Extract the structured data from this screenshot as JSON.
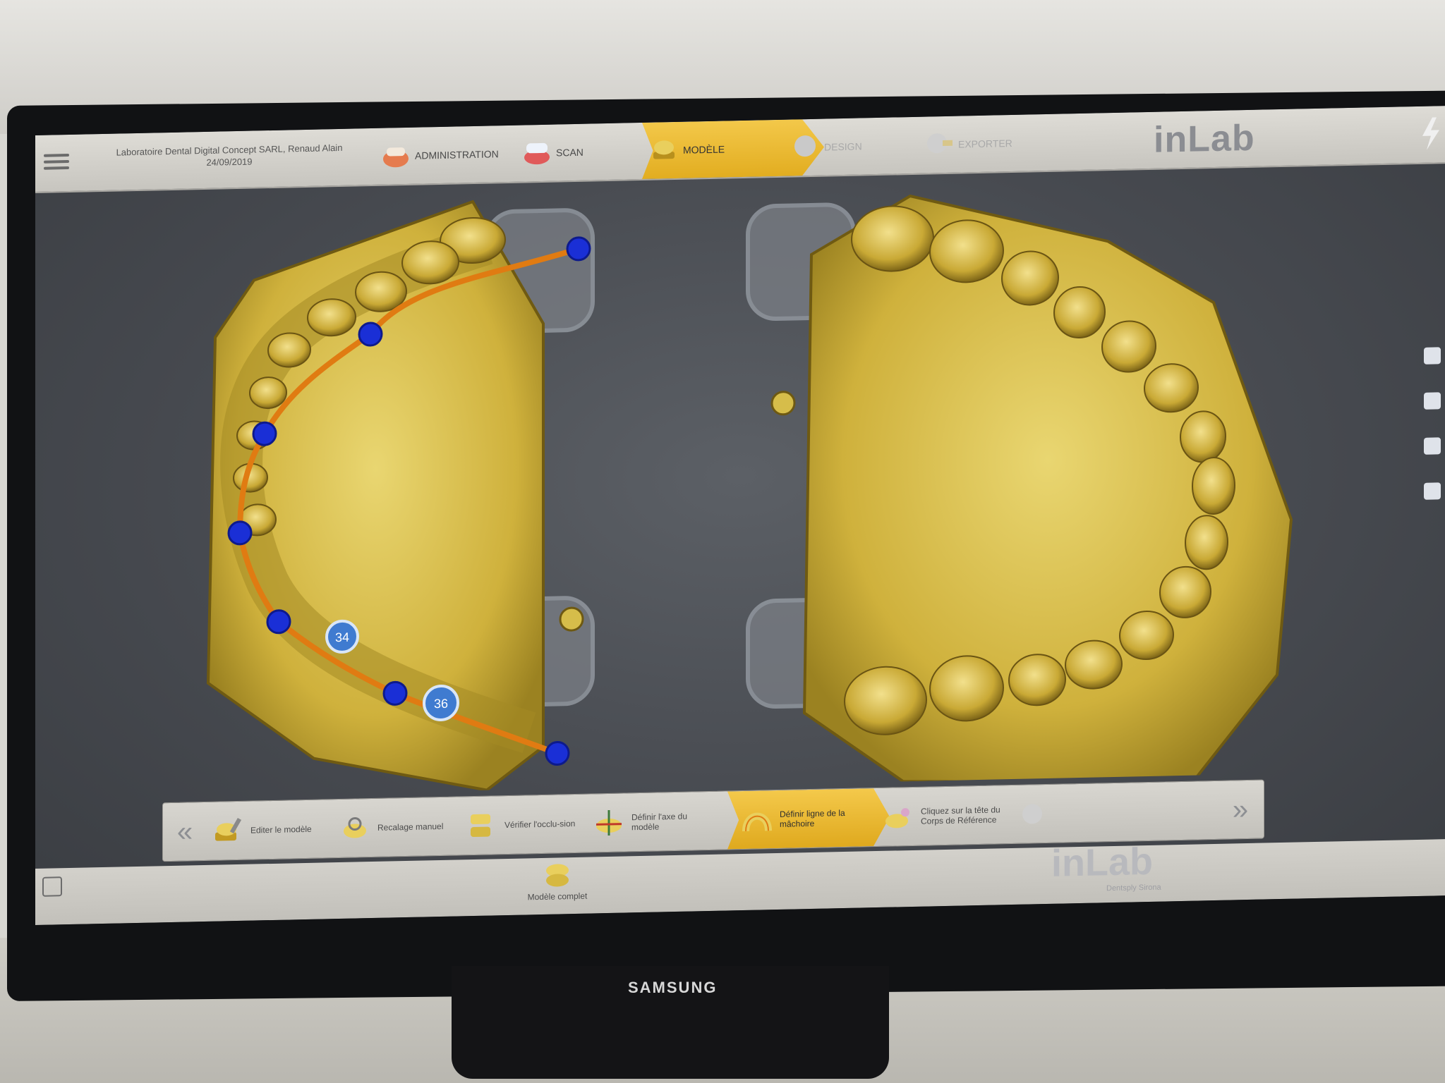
{
  "header": {
    "lab_name": "Laboratoire Dental Digital Concept SARL, Renaud Alain",
    "date": "24/09/2019",
    "steps": [
      {
        "label": "ADMINISTRATION",
        "icon": "administration-icon",
        "state": "done"
      },
      {
        "label": "SCAN",
        "icon": "scan-icon",
        "state": "done"
      },
      {
        "label": "MODÈLE",
        "icon": "model-icon",
        "state": "active"
      },
      {
        "label": "DESIGN",
        "icon": "design-icon",
        "state": "disabled"
      },
      {
        "label": "EXPORTER",
        "icon": "export-icon",
        "state": "disabled"
      }
    ],
    "logo": "inLab"
  },
  "viewport": {
    "markers": [
      "34",
      "36"
    ],
    "colors": {
      "model": "#d9c04a",
      "curve": "#e07b12",
      "point": "#1a2fd6"
    }
  },
  "toolbar": {
    "tools": [
      {
        "label": "Editer le modèle",
        "icon": "edit-model-icon",
        "state": "normal"
      },
      {
        "label": "Recalage manuel",
        "icon": "manual-registration-icon",
        "state": "normal"
      },
      {
        "label": "Vérifier l'occlu-sion",
        "icon": "check-occlusion-icon",
        "state": "normal"
      },
      {
        "label": "Définir l'axe du modèle",
        "icon": "model-axis-icon",
        "state": "normal"
      },
      {
        "label": "Définir ligne de la mâchoire",
        "icon": "jaw-line-icon",
        "state": "active"
      },
      {
        "label": "Cliquez sur la tête du Corps de Référence",
        "icon": "reference-body-icon",
        "state": "normal"
      },
      {
        "label": "",
        "icon": "disabled-tool-icon",
        "state": "disabled"
      }
    ]
  },
  "bottom": {
    "complete_label": "Modèle complet",
    "logo": "inLab",
    "sub_logo": "Dentsply Sirona"
  },
  "monitor_brand": "SAMSUNG"
}
